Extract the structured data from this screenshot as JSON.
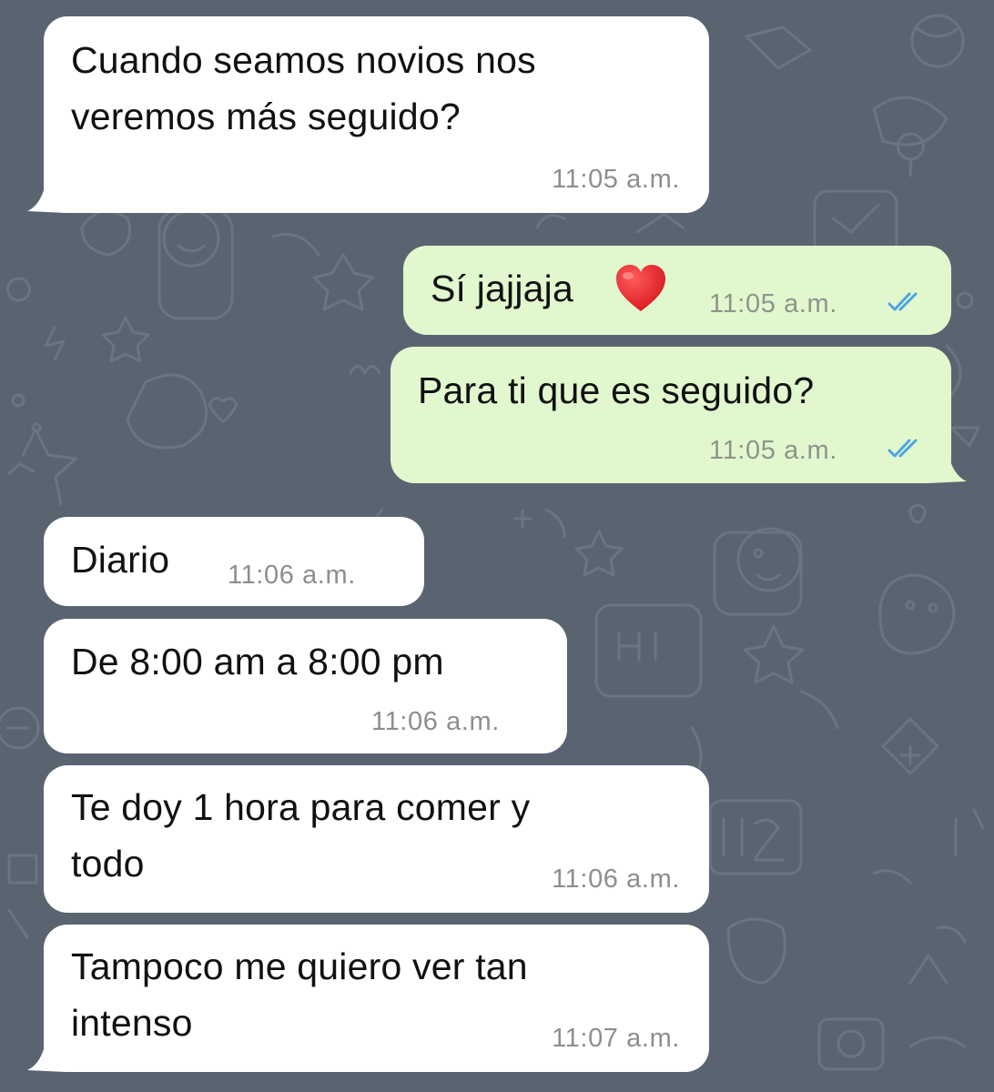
{
  "chat": {
    "messages": [
      {
        "direction": "incoming",
        "line1": "Cuando seamos novios nos",
        "line2": "veremos más seguido?",
        "time": "11:05 a.m."
      },
      {
        "direction": "outgoing",
        "text": "Sí jajjaja",
        "emoji": "red-heart",
        "time": "11:05 a.m.",
        "status": "read"
      },
      {
        "direction": "outgoing",
        "text": "Para ti que es seguido?",
        "time": "11:05 a.m.",
        "status": "read"
      },
      {
        "direction": "incoming",
        "text": "Diario",
        "time": "11:06 a.m."
      },
      {
        "direction": "incoming",
        "text": "De 8:00 am a 8:00 pm",
        "time": "11:06 a.m."
      },
      {
        "direction": "incoming",
        "line1": "Te doy 1 hora para comer y",
        "line2": "todo",
        "time": "11:06 a.m."
      },
      {
        "direction": "incoming",
        "line1": "Tampoco me quiero ver tan",
        "line2": "intenso",
        "time": "11:07 a.m."
      }
    ]
  },
  "colors": {
    "background": "#5b6572",
    "incoming_bubble": "#ffffff",
    "outgoing_bubble": "#e1f8cf",
    "read_ticks": "#4fa3e0",
    "timestamp": "#8e8e8e"
  }
}
